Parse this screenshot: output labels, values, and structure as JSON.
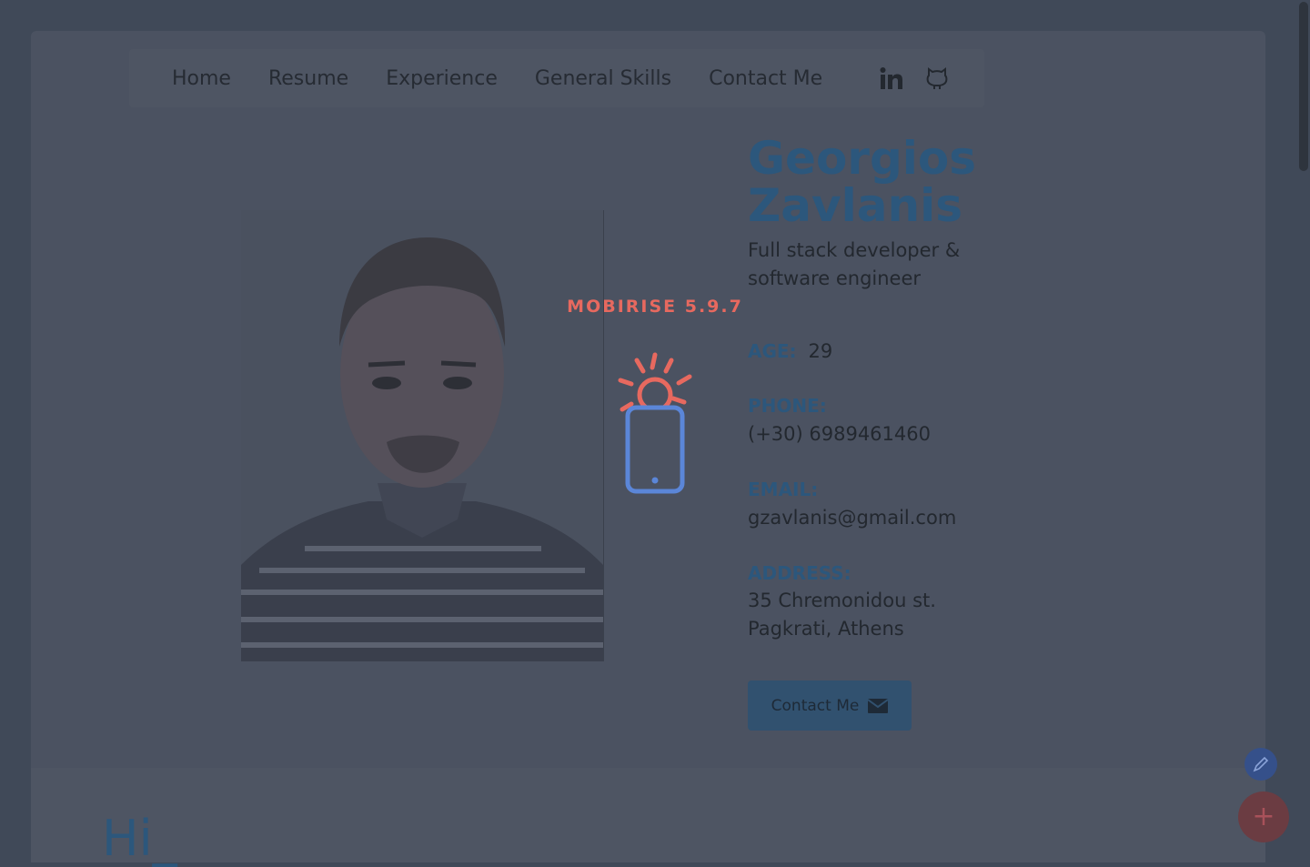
{
  "nav": {
    "links": [
      "Home",
      "Resume",
      "Experience",
      "General Skills",
      "Contact Me"
    ],
    "icons": [
      "linkedin-icon",
      "github-icon"
    ]
  },
  "profile": {
    "name_line1": "Georgios",
    "name_line2": "Zavlanis",
    "role": "Full stack developer & software engineer",
    "age_label": "AGE:",
    "age_value": "29",
    "phone_label": "PHONE:",
    "phone_value": "(+30) 6989461460",
    "email_label": "EMAIL:",
    "email_value": "gzavlanis@gmail.com",
    "address_label": "ADDRESS:",
    "address_line1": "35 Chremonidou st.",
    "address_line2": "Pagkrati, Athens",
    "contact_button": "Contact Me"
  },
  "intro": {
    "heading": "Hi_"
  },
  "overlay": {
    "brand": "MOBIRISE  5.9.7"
  },
  "colors": {
    "accent": "#2c577c",
    "brand_red": "#e7695f",
    "phone_blue": "#5b86d8",
    "backdrop": "#404958"
  }
}
